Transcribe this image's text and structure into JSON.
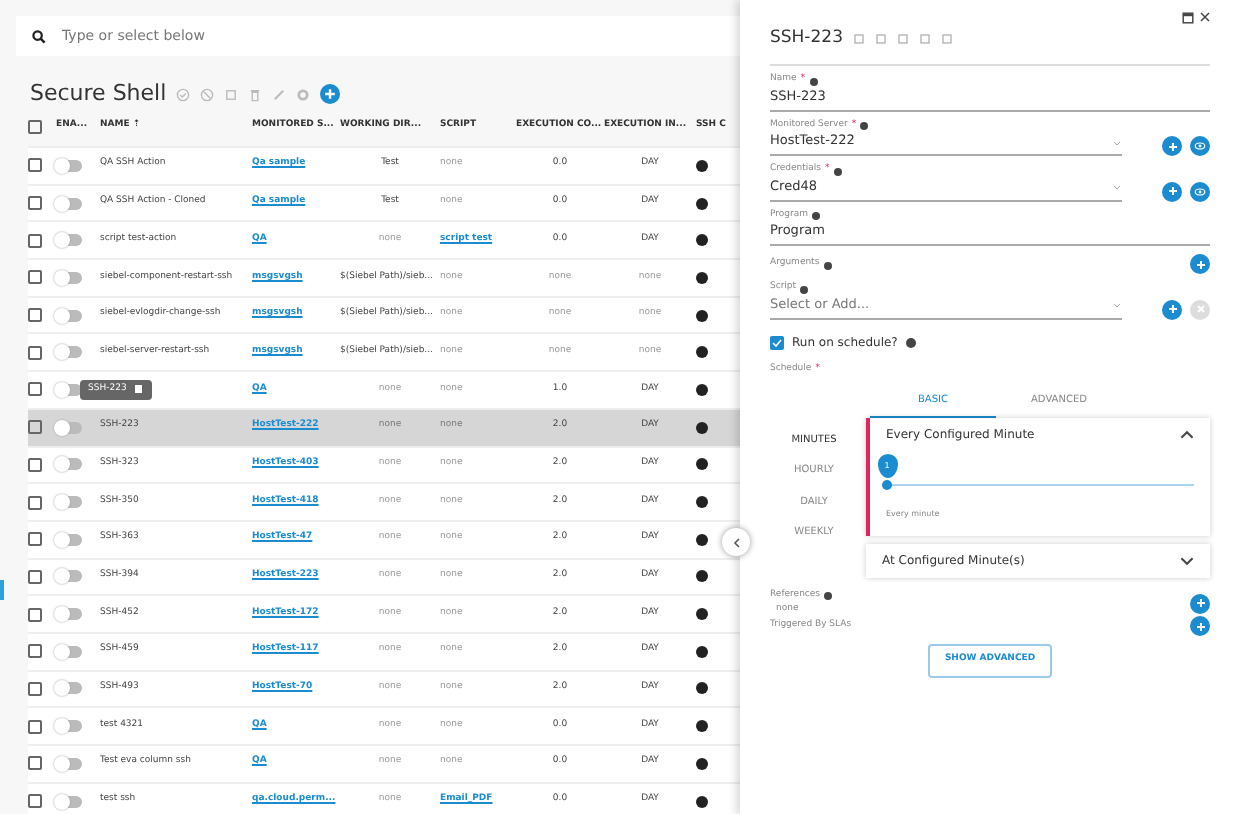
{
  "search": {
    "placeholder": "Type or select below"
  },
  "list": {
    "title": "Secure Shell",
    "select_all_checked": false,
    "toggle_column": "ENA...",
    "columns": [
      "NAME ⇡",
      "MONITORED S...",
      "WORKING DIR...",
      "SCRIPT",
      "EXECUTION CO...",
      "EXECUTION IN...",
      "SSH C"
    ],
    "rows": [
      {
        "selected": false,
        "checked": false,
        "enabled": false,
        "cells": [
          {
            "text": "QA SSH Action",
            "kind": "text"
          },
          {
            "text": "Qa sample",
            "kind": "link"
          },
          {
            "text": "Test",
            "kind": "text"
          },
          {
            "text": "none",
            "kind": "none"
          },
          {
            "text": "0.0",
            "kind": "text"
          },
          {
            "text": "DAY",
            "kind": "text"
          }
        ]
      },
      {
        "selected": false,
        "checked": false,
        "enabled": false,
        "cells": [
          {
            "text": "QA SSH Action - Cloned",
            "kind": "text"
          },
          {
            "text": "Qa sample",
            "kind": "link"
          },
          {
            "text": "Test",
            "kind": "text"
          },
          {
            "text": "none",
            "kind": "none"
          },
          {
            "text": "0.0",
            "kind": "text"
          },
          {
            "text": "DAY",
            "kind": "text"
          }
        ]
      },
      {
        "selected": false,
        "checked": false,
        "enabled": false,
        "cells": [
          {
            "text": "script test-action",
            "kind": "text"
          },
          {
            "text": "QA",
            "kind": "link"
          },
          {
            "text": "none",
            "kind": "none"
          },
          {
            "text": "script test",
            "kind": "link"
          },
          {
            "text": "0.0",
            "kind": "text"
          },
          {
            "text": "DAY",
            "kind": "text"
          }
        ]
      },
      {
        "selected": false,
        "checked": false,
        "enabled": false,
        "cells": [
          {
            "text": "siebel-component-restart-ssh",
            "kind": "text"
          },
          {
            "text": "msgsvgsh",
            "kind": "link"
          },
          {
            "text": "$(Siebel Path)/sieb...",
            "kind": "text"
          },
          {
            "text": "none",
            "kind": "none"
          },
          {
            "text": "none",
            "kind": "none"
          },
          {
            "text": "none",
            "kind": "none"
          }
        ]
      },
      {
        "selected": false,
        "checked": false,
        "enabled": false,
        "cells": [
          {
            "text": "siebel-evlogdir-change-ssh",
            "kind": "text"
          },
          {
            "text": "msgsvgsh",
            "kind": "link"
          },
          {
            "text": "$(Siebel Path)/sieb...",
            "kind": "text"
          },
          {
            "text": "none",
            "kind": "none"
          },
          {
            "text": "none",
            "kind": "none"
          },
          {
            "text": "none",
            "kind": "none"
          }
        ]
      },
      {
        "selected": false,
        "checked": false,
        "enabled": false,
        "cells": [
          {
            "text": "siebel-server-restart-ssh",
            "kind": "text"
          },
          {
            "text": "msgsvgsh",
            "kind": "link"
          },
          {
            "text": "$(Siebel Path)/sieb...",
            "kind": "text"
          },
          {
            "text": "none",
            "kind": "none"
          },
          {
            "text": "none",
            "kind": "none"
          },
          {
            "text": "none",
            "kind": "none"
          }
        ]
      },
      {
        "selected": false,
        "checked": false,
        "enabled": false,
        "cells": [
          {
            "text": "SSH-223",
            "kind": "tooltip"
          },
          {
            "text": "QA",
            "kind": "link"
          },
          {
            "text": "none",
            "kind": "none"
          },
          {
            "text": "none",
            "kind": "none"
          },
          {
            "text": "1.0",
            "kind": "text"
          },
          {
            "text": "DAY",
            "kind": "text"
          }
        ]
      },
      {
        "selected": true,
        "checked": false,
        "enabled": false,
        "cells": [
          {
            "text": "SSH-223",
            "kind": "text"
          },
          {
            "text": "HostTest-222",
            "kind": "link"
          },
          {
            "text": "none",
            "kind": "none"
          },
          {
            "text": "none",
            "kind": "none"
          },
          {
            "text": "2.0",
            "kind": "text"
          },
          {
            "text": "DAY",
            "kind": "text"
          }
        ]
      },
      {
        "selected": false,
        "checked": false,
        "enabled": false,
        "cells": [
          {
            "text": "SSH-323",
            "kind": "text"
          },
          {
            "text": "HostTest-403",
            "kind": "link"
          },
          {
            "text": "none",
            "kind": "none"
          },
          {
            "text": "none",
            "kind": "none"
          },
          {
            "text": "2.0",
            "kind": "text"
          },
          {
            "text": "DAY",
            "kind": "text"
          }
        ]
      },
      {
        "selected": false,
        "checked": false,
        "enabled": false,
        "cells": [
          {
            "text": "SSH-350",
            "kind": "text"
          },
          {
            "text": "HostTest-418",
            "kind": "link"
          },
          {
            "text": "none",
            "kind": "none"
          },
          {
            "text": "none",
            "kind": "none"
          },
          {
            "text": "2.0",
            "kind": "text"
          },
          {
            "text": "DAY",
            "kind": "text"
          }
        ]
      },
      {
        "selected": false,
        "checked": false,
        "enabled": false,
        "cells": [
          {
            "text": "SSH-363",
            "kind": "text"
          },
          {
            "text": "HostTest-47",
            "kind": "link"
          },
          {
            "text": "none",
            "kind": "none"
          },
          {
            "text": "none",
            "kind": "none"
          },
          {
            "text": "2.0",
            "kind": "text"
          },
          {
            "text": "DAY",
            "kind": "text"
          }
        ]
      },
      {
        "selected": false,
        "checked": false,
        "enabled": false,
        "cells": [
          {
            "text": "SSH-394",
            "kind": "text"
          },
          {
            "text": "HostTest-223",
            "kind": "link"
          },
          {
            "text": "none",
            "kind": "none"
          },
          {
            "text": "none",
            "kind": "none"
          },
          {
            "text": "2.0",
            "kind": "text"
          },
          {
            "text": "DAY",
            "kind": "text"
          }
        ]
      },
      {
        "selected": false,
        "checked": false,
        "enabled": false,
        "cells": [
          {
            "text": "SSH-452",
            "kind": "text"
          },
          {
            "text": "HostTest-172",
            "kind": "link"
          },
          {
            "text": "none",
            "kind": "none"
          },
          {
            "text": "none",
            "kind": "none"
          },
          {
            "text": "2.0",
            "kind": "text"
          },
          {
            "text": "DAY",
            "kind": "text"
          }
        ]
      },
      {
        "selected": false,
        "checked": false,
        "enabled": false,
        "cells": [
          {
            "text": "SSH-459",
            "kind": "text"
          },
          {
            "text": "HostTest-117",
            "kind": "link"
          },
          {
            "text": "none",
            "kind": "none"
          },
          {
            "text": "none",
            "kind": "none"
          },
          {
            "text": "2.0",
            "kind": "text"
          },
          {
            "text": "DAY",
            "kind": "text"
          }
        ]
      },
      {
        "selected": false,
        "checked": false,
        "enabled": false,
        "cells": [
          {
            "text": "SSH-493",
            "kind": "text"
          },
          {
            "text": "HostTest-70",
            "kind": "link"
          },
          {
            "text": "none",
            "kind": "none"
          },
          {
            "text": "none",
            "kind": "none"
          },
          {
            "text": "2.0",
            "kind": "text"
          },
          {
            "text": "DAY",
            "kind": "text"
          }
        ]
      },
      {
        "selected": false,
        "checked": false,
        "enabled": false,
        "cells": [
          {
            "text": "test 4321",
            "kind": "text"
          },
          {
            "text": "QA",
            "kind": "link"
          },
          {
            "text": "none",
            "kind": "none"
          },
          {
            "text": "none",
            "kind": "none"
          },
          {
            "text": "0.0",
            "kind": "text"
          },
          {
            "text": "DAY",
            "kind": "text"
          }
        ]
      },
      {
        "selected": false,
        "checked": false,
        "enabled": false,
        "cells": [
          {
            "text": "Test eva column ssh",
            "kind": "text"
          },
          {
            "text": "QA",
            "kind": "link"
          },
          {
            "text": "none",
            "kind": "none"
          },
          {
            "text": "none",
            "kind": "none"
          },
          {
            "text": "0.0",
            "kind": "text"
          },
          {
            "text": "DAY",
            "kind": "text"
          }
        ]
      },
      {
        "selected": false,
        "checked": false,
        "enabled": false,
        "cells": [
          {
            "text": "test ssh",
            "kind": "text"
          },
          {
            "text": "qa.cloud.perm...",
            "kind": "link"
          },
          {
            "text": "none",
            "kind": "none"
          },
          {
            "text": "Email_PDF",
            "kind": "link"
          },
          {
            "text": "0.0",
            "kind": "text"
          },
          {
            "text": "DAY",
            "kind": "text"
          }
        ]
      }
    ]
  },
  "panel": {
    "title": "SSH-223",
    "fields": [
      {
        "kind": "text",
        "label": "Name",
        "required_mark": "*",
        "value": "SSH-223"
      },
      {
        "kind": "select",
        "label": "Monitored Server",
        "required_mark": "*",
        "value": "HostTest-222",
        "add": true,
        "view": true
      },
      {
        "kind": "select",
        "label": "Credentials",
        "required_mark": "*",
        "value": "Cred48",
        "add": true,
        "view": true
      },
      {
        "kind": "text",
        "label": "Program",
        "value": "Program"
      },
      {
        "kind": "list",
        "label": "Arguments",
        "add": true
      },
      {
        "kind": "select",
        "label": "Script",
        "placeholder": "Select or Add...",
        "add": true,
        "clear": true
      }
    ],
    "run_on_schedule": {
      "label": "Run on schedule?",
      "checked": true
    },
    "schedule": {
      "label": "Schedule",
      "required_mark": "*",
      "tabs": [
        {
          "label": "BASIC",
          "selected": true
        },
        {
          "label": "ADVANCED",
          "selected": false
        }
      ],
      "frequencies": [
        {
          "label": "MINUTES",
          "selected": true
        },
        {
          "label": "HOURLY",
          "selected": false
        },
        {
          "label": "DAILY",
          "selected": false
        },
        {
          "label": "WEEKLY",
          "selected": false
        }
      ],
      "sections": [
        {
          "title": "Every Configured Minute",
          "expanded": true,
          "slider": {
            "value": "1",
            "level": 0,
            "caption": "Every minute"
          }
        },
        {
          "title": "At Configured Minute(s)",
          "expanded": false
        }
      ]
    },
    "references": {
      "label": "References",
      "value": "none"
    },
    "triggered_by": {
      "label": "Triggered By SLAs"
    },
    "show_advanced": "SHOW ADVANCED"
  }
}
